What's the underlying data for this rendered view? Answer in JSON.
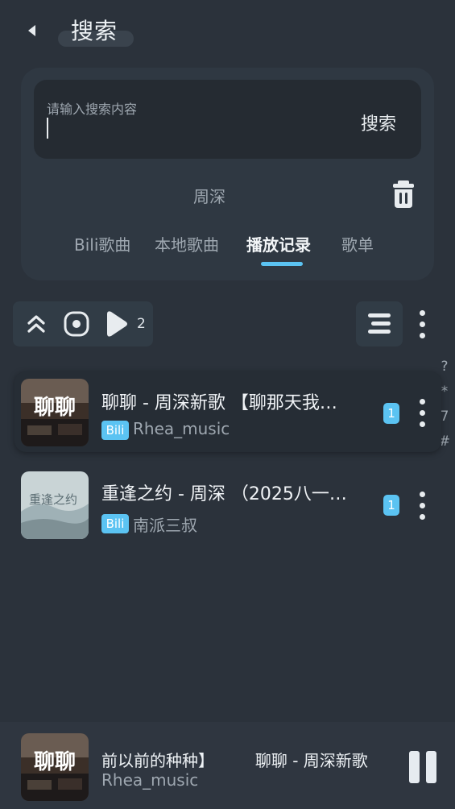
{
  "header": {
    "title": "搜索"
  },
  "search": {
    "placeholder": "请输入搜索内容",
    "button_label": "搜索",
    "history": [
      "周深"
    ]
  },
  "tabs": [
    {
      "label": "Bili歌曲",
      "active": false
    },
    {
      "label": "本地歌曲",
      "active": false
    },
    {
      "label": "播放记录",
      "active": true
    },
    {
      "label": "歌单",
      "active": false
    }
  ],
  "toolbar": {
    "icons": [
      "double-chevron-up-icon",
      "locate-icon",
      "play-icon"
    ],
    "play_count": "2"
  },
  "side_index": [
    "?",
    "*",
    "7",
    "#"
  ],
  "songs": [
    {
      "title": "聊聊 - 周深新歌 【聊那天我…",
      "source": "Bili",
      "artist": "Rhea_music",
      "count": "1",
      "cover_text": "聊聊"
    },
    {
      "title": "重逢之约 - 周深 （2025八一…",
      "source": "Bili",
      "artist": "南派三叔",
      "count": "1",
      "cover_text": "重逢之约"
    }
  ],
  "player": {
    "title": "前以前的种种】        聊聊 - 周深新歌",
    "artist": "Rhea_music",
    "cover_text": "聊聊"
  },
  "colors": {
    "background": "#2b323b",
    "accent": "#5bc3f2",
    "card": "#2f3842"
  }
}
